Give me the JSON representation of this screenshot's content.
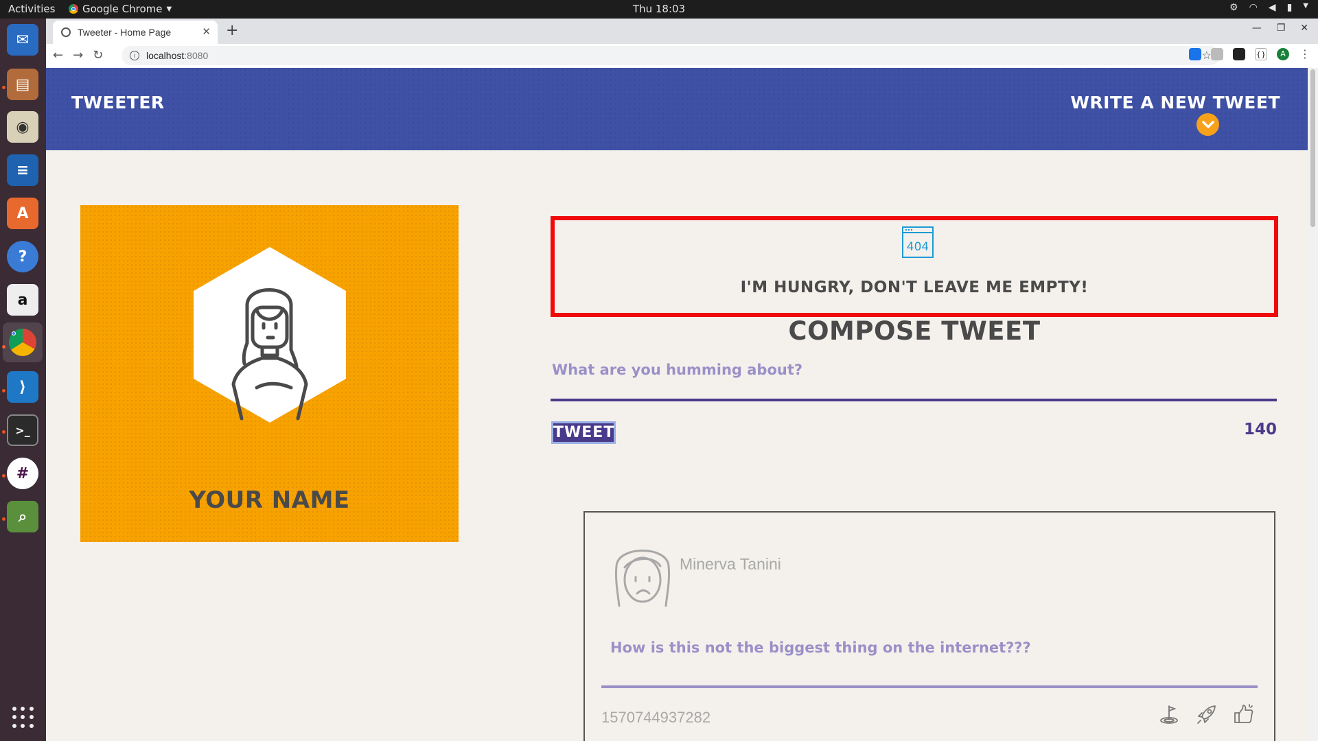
{
  "os": {
    "activities": "Activities",
    "app_name": "Google Chrome",
    "clock": "Thu 18:03"
  },
  "browser": {
    "tab_title": "Tweeter - Home Page",
    "url_host": "localhost",
    "url_port": ":8080"
  },
  "header": {
    "brand": "TWEETER",
    "write_link": "WRITE A NEW TWEET"
  },
  "profile": {
    "name": "YOUR NAME"
  },
  "error": {
    "icon_text": "404",
    "message": "I'M HUNGRY, DON'T LEAVE ME EMPTY!"
  },
  "compose": {
    "title": "COMPOSE TWEET",
    "placeholder": "What are you humming about?",
    "button_label": "TWEET",
    "counter": "140"
  },
  "tweets": [
    {
      "author": "Minerva Tanini",
      "content": "How is this not the biggest thing on the internet???",
      "timestamp": "1570744937282"
    }
  ],
  "colors": {
    "header_bg": "#3f51a5",
    "profile_bg": "#f7a200",
    "accent_purple": "#4a3a8a",
    "error_border": "#ef0b0b"
  }
}
